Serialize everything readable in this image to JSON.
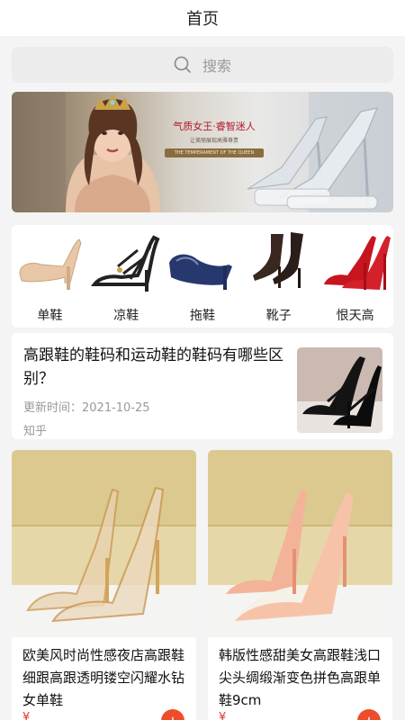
{
  "header": {
    "title": "首页"
  },
  "search": {
    "placeholder": "搜索",
    "icon": "search-icon"
  },
  "banner": {
    "slogan": "气质女王·睿智迷人",
    "subtitle": "让美丽展现高雅尊贵",
    "band_text": "THE TEMPERAMENT OF THE QUEEN"
  },
  "categories": [
    {
      "label": "单鞋",
      "color": "#e8c7a6"
    },
    {
      "label": "凉鞋",
      "color": "#222222"
    },
    {
      "label": "拖鞋",
      "color": "#26386e"
    },
    {
      "label": "靴子",
      "color": "#3a2820"
    },
    {
      "label": "恨天高",
      "color": "#c8141e"
    }
  ],
  "article": {
    "title": "高跟鞋的鞋码和运动鞋的鞋码有哪些区别？",
    "date": "更新时间：2021-10-25",
    "source": "知乎"
  },
  "products": [
    {
      "name": "欧美风时尚性感夜店高跟鞋细跟高跟透明镂空闪耀水钻女单鞋",
      "price": "¥",
      "accent": "#d9a46a"
    },
    {
      "name": "韩版性感甜美女高跟鞋浅口尖头绸缎渐变色拼色高跟单鞋9cm",
      "price": "¥",
      "accent": "#f2a58c"
    }
  ],
  "colors": {
    "accent": "#ee4d2d",
    "price": "#e1332d"
  }
}
